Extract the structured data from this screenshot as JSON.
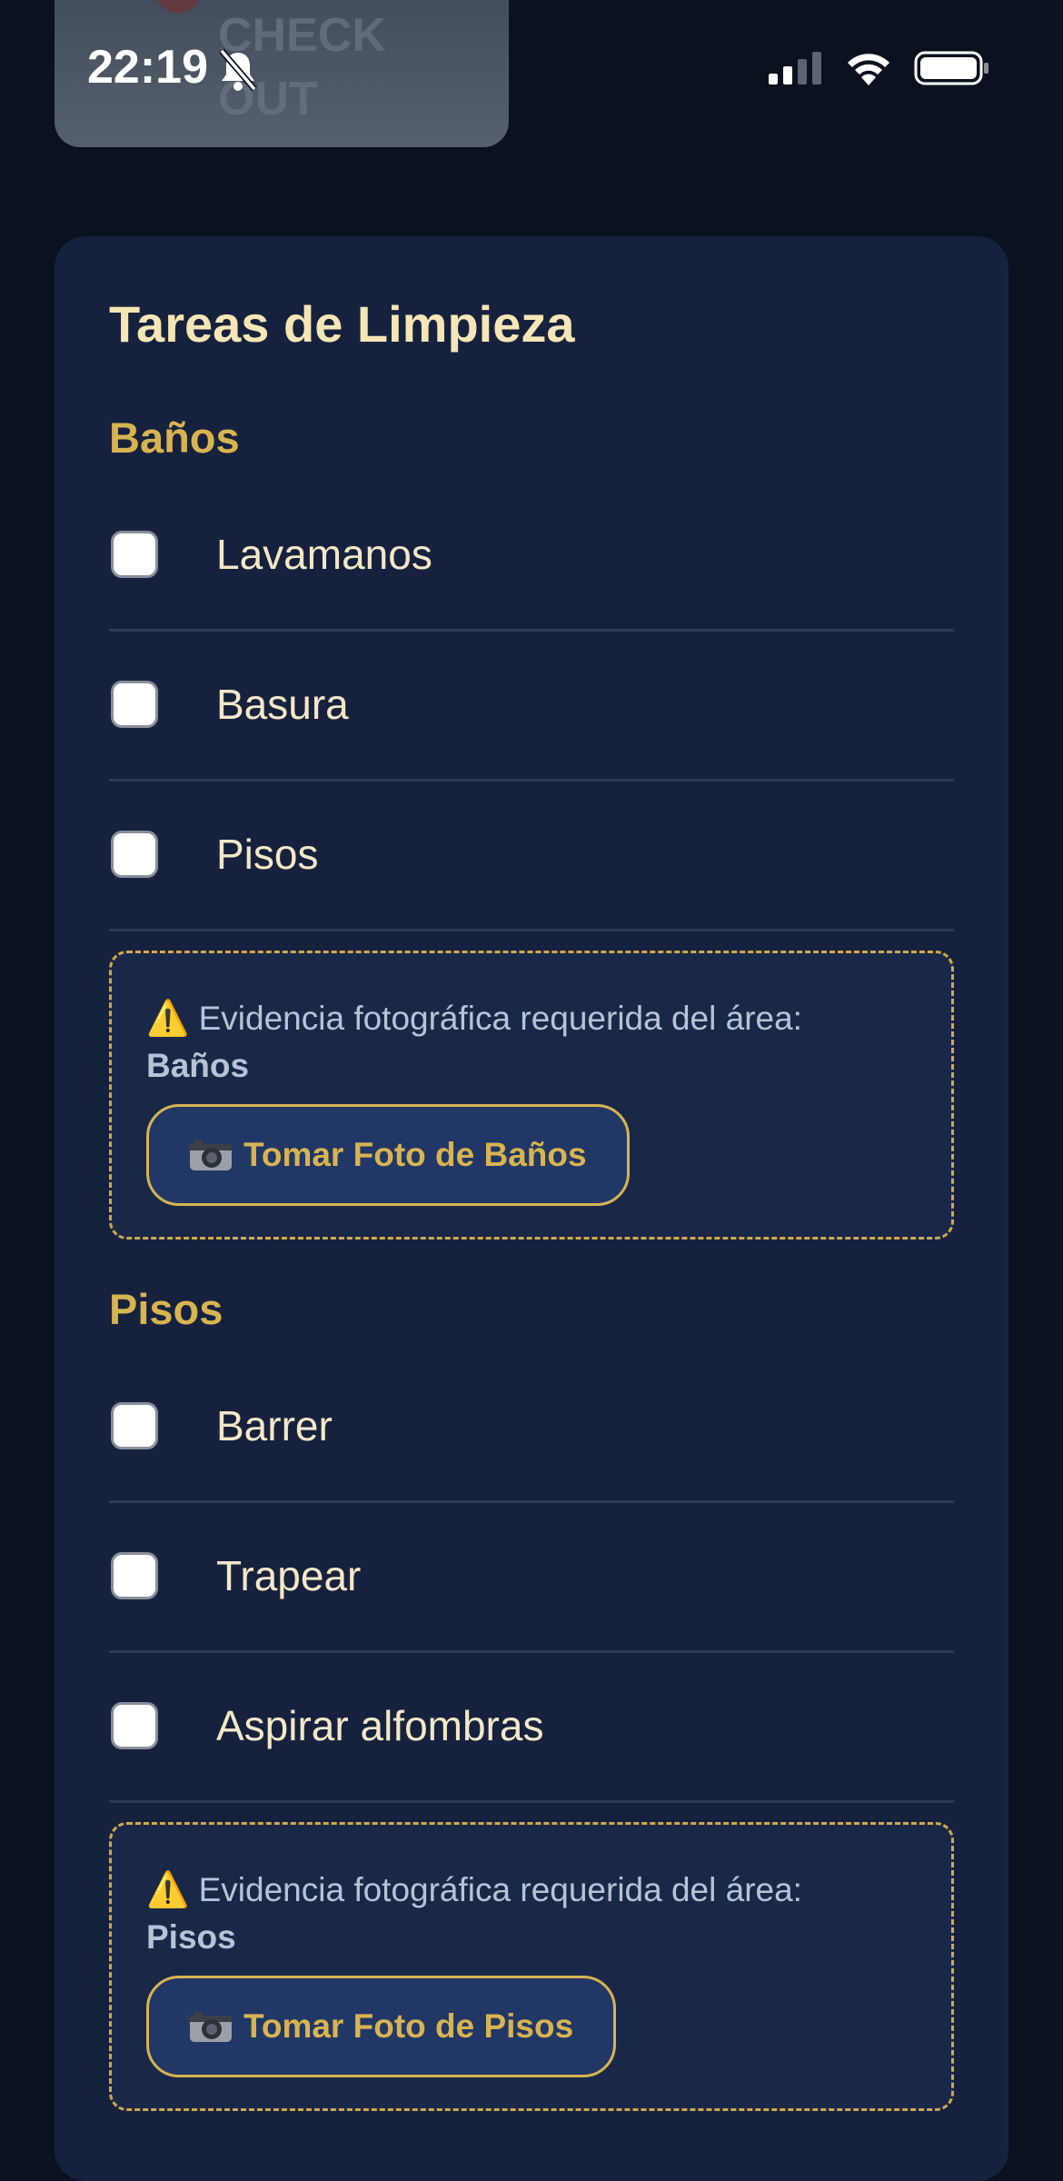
{
  "status_bar": {
    "time": "22:19"
  },
  "top_card": {
    "ghost_text": "CHECK OUT"
  },
  "card": {
    "title": "Tareas de Limpieza",
    "sections": [
      {
        "title": "Baños",
        "tasks": [
          "Lavamanos",
          "Basura",
          "Pisos"
        ],
        "evidence": {
          "warning_icon": "⚠️",
          "text": "Evidencia fotográfica requerida del área:",
          "area": "Baños",
          "button_icon": "camera-icon",
          "button_label": "Tomar Foto de Baños"
        }
      },
      {
        "title": "Pisos",
        "tasks": [
          "Barrer",
          "Trapear",
          "Aspirar alfombras"
        ],
        "evidence": {
          "warning_icon": "⚠️",
          "text": "Evidencia fotográfica requerida del área:",
          "area": "Pisos",
          "button_icon": "camera-icon",
          "button_label": "Tomar Foto de Pisos"
        }
      }
    ]
  },
  "colors": {
    "background": "#0a111f",
    "card": "#16223d",
    "accent_gold": "#d8b451",
    "title_cream": "#f7e6b5"
  }
}
